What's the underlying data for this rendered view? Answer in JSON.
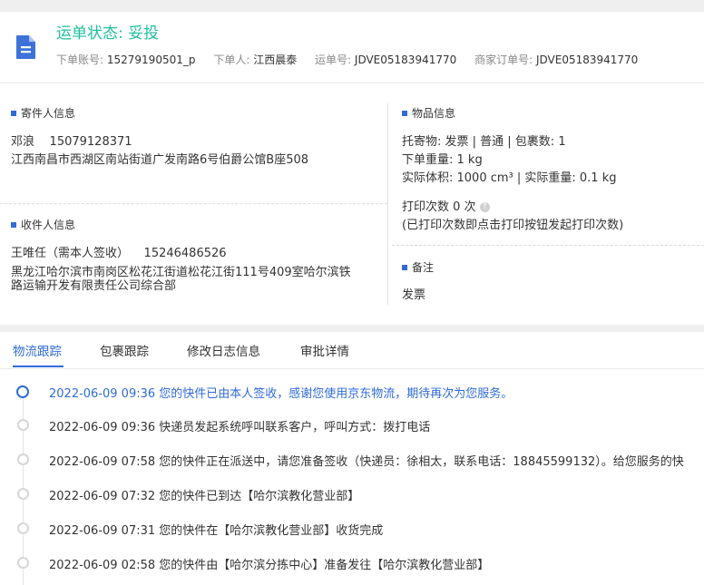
{
  "header": {
    "status_title": "运单状态: 妥投",
    "order_account_label": "下单账号:",
    "order_account_value": "15279190501_p",
    "orderer_label": "下单人:",
    "orderer_value": "江西晨泰",
    "waybill_label": "运单号:",
    "waybill_value": "JDVE05183941770",
    "merchant_order_label": "商家订单号:",
    "merchant_order_value": "JDVE05183941770"
  },
  "sender": {
    "title": "寄件人信息",
    "name": "邓浪",
    "phone": "15079128371",
    "address": "江西南昌市西湖区南站街道广发南路6号伯爵公馆B座508"
  },
  "receiver": {
    "title": "收件人信息",
    "name": "王唯任（需本人签收）",
    "phone": "15246486526",
    "address_line1": "黑龙江哈尔滨市南岗区松花江街道松花江街111号409室哈尔滨铁",
    "address_line2": "路运输开发有限责任公司综合部"
  },
  "goods": {
    "title": "物品信息",
    "line1": "托寄物:  发票 | 普通  |  包裹数:   1",
    "line2": "下单重量:   1 kg",
    "line3": "实际体积:    1000 cm³  |  实际重量:    0.1 kg",
    "print_count": "打印次数    0 次",
    "print_hint": "(已打印次数即点击打印按钮发起打印次数)"
  },
  "remarks": {
    "title": "备注",
    "text": "发票"
  },
  "tabs": [
    "物流跟踪",
    "包裹跟踪",
    "修改日志信息",
    "审批详情"
  ],
  "timeline": [
    "2022-06-09 09:36 您的快件已由本人签收，感谢您使用京东物流，期待再次为您服务。",
    "2022-06-09 09:36 快递员发起系统呼叫联系客户，呼叫方式：拨打电话",
    "2022-06-09 07:58 您的快件正在派送中，请您准备签收（快递员：徐相太，联系电话：18845599132）。给您服务的快",
    "2022-06-09 07:32 您的快件已到达【哈尔滨教化营业部】",
    "2022-06-09 07:31 您的快件在【哈尔滨教化营业部】收货完成",
    "2022-06-09 02:58 您的快件由【哈尔滨分拣中心】准备发往【哈尔滨教化营业部】"
  ],
  "colors": {
    "accent": "#2f6bd8",
    "status": "#1fbfa0"
  },
  "icons": {
    "header": "document-icon",
    "help": "question-circle-icon"
  }
}
